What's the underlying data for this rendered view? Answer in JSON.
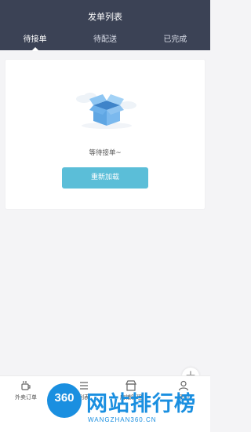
{
  "header": {
    "title": "发单列表",
    "tabs": [
      {
        "label": "待接单",
        "active": true
      },
      {
        "label": "待配送",
        "active": false
      },
      {
        "label": "已完成",
        "active": false
      }
    ]
  },
  "empty_state": {
    "message": "等待接单~",
    "reload_label": "重新加载",
    "illustration_icon": "open-box-icon"
  },
  "fab": {
    "icon": "plus-icon",
    "glyph": "+"
  },
  "bottom_nav": {
    "items": [
      {
        "label": "外卖订单",
        "icon": "takeout-icon"
      },
      {
        "label": "列表",
        "icon": "list-icon"
      },
      {
        "label": "店铺管理",
        "icon": "store-icon"
      },
      {
        "label": "我的",
        "icon": "user-icon"
      }
    ]
  },
  "watermark": {
    "circle_text": "360",
    "title": "网站排行榜",
    "url": "WANGZHAN360.CN"
  },
  "colors": {
    "header_bg": "#3b4255",
    "button_bg": "#5bbed8",
    "page_bg": "#f4f4f6",
    "watermark_blue": "#1a8fe0"
  }
}
